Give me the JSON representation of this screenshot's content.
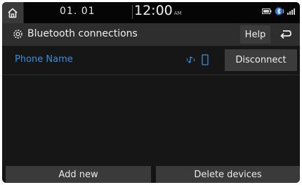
{
  "status": {
    "date": "01. 01",
    "time": "12:00",
    "ampm": "AM"
  },
  "header": {
    "title": "Bluetooth connections",
    "help_label": "Help"
  },
  "devices": [
    {
      "name": "Phone Name",
      "action_label": "Disconnect"
    }
  ],
  "footer": {
    "add_new_label": "Add new",
    "delete_devices_label": "Delete devices"
  },
  "colors": {
    "accent_blue": "#3a8fdc",
    "background": "#161616",
    "button": "#3c3c3c"
  }
}
